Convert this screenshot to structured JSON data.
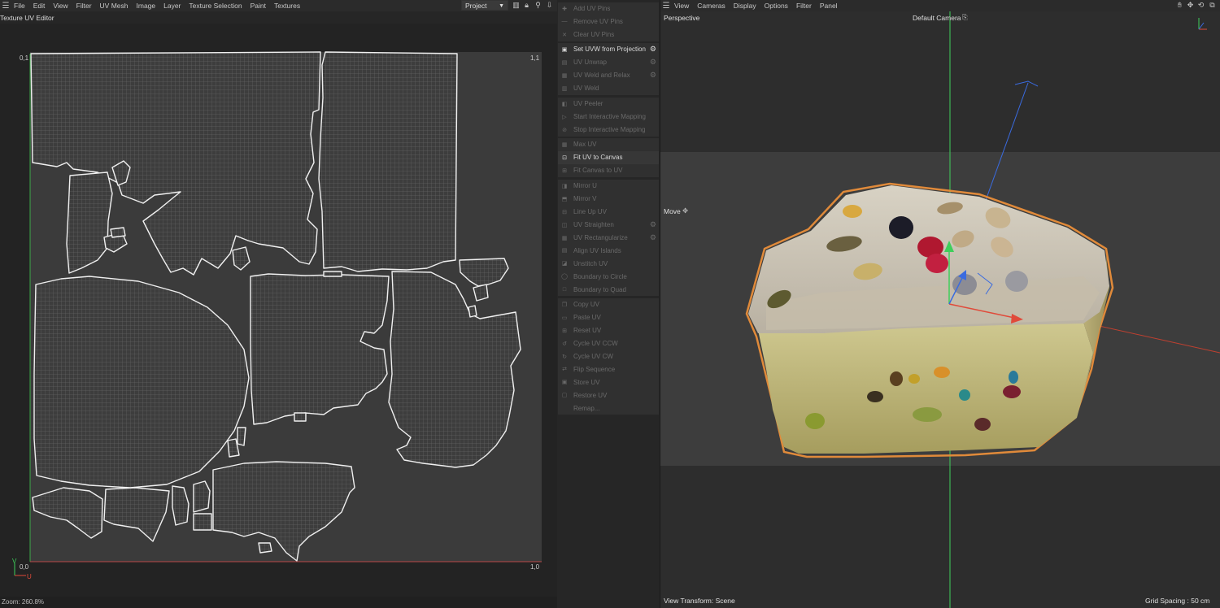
{
  "uv_editor": {
    "menu": [
      "File",
      "Edit",
      "View",
      "Filter",
      "UV Mesh",
      "Image",
      "Layer",
      "Texture Selection",
      "Paint",
      "Textures"
    ],
    "project_select": "Project",
    "title": "Texture UV Editor",
    "corners": {
      "top_left": "0,1",
      "top_right": "1,1",
      "bottom_left": "0,0",
      "bottom_right": "1,0"
    },
    "axis_v": "V",
    "axis_u": "U",
    "zoom": "Zoom: 260.8%"
  },
  "commands": {
    "group1": [
      {
        "label": "Add UV Pins",
        "icon": "pin-add-icon",
        "enabled": false
      },
      {
        "label": "Remove UV Pins",
        "icon": "pin-remove-icon",
        "enabled": false
      },
      {
        "label": "Clear UV Pins",
        "icon": "pin-clear-icon",
        "enabled": false
      }
    ],
    "group2": [
      {
        "label": "Set UVW from Projection",
        "icon": "projection-icon",
        "enabled": true,
        "gear": true
      },
      {
        "label": "UV Unwrap",
        "icon": "unwrap-icon",
        "enabled": false,
        "gear": true
      },
      {
        "label": "UV Weld and Relax",
        "icon": "weld-relax-icon",
        "enabled": false,
        "gear": true
      },
      {
        "label": "UV Weld",
        "icon": "weld-icon",
        "enabled": false
      }
    ],
    "group3": [
      {
        "label": "UV Peeler",
        "icon": "peeler-icon",
        "enabled": false
      },
      {
        "label": "Start Interactive Mapping",
        "icon": "play-icon",
        "enabled": false
      },
      {
        "label": "Stop Interactive Mapping",
        "icon": "stop-icon",
        "enabled": false
      }
    ],
    "group4": [
      {
        "label": "Max UV",
        "icon": "max-uv-icon",
        "enabled": false
      },
      {
        "label": "Fit UV to Canvas",
        "icon": "fit-uv-icon",
        "enabled": true
      },
      {
        "label": "Fit Canvas to UV",
        "icon": "fit-canvas-icon",
        "enabled": false
      }
    ],
    "group5": [
      {
        "label": "Mirror U",
        "icon": "mirror-u-icon",
        "enabled": false
      },
      {
        "label": "Mirror V",
        "icon": "mirror-v-icon",
        "enabled": false
      },
      {
        "label": "Line Up UV",
        "icon": "line-up-icon",
        "enabled": false
      },
      {
        "label": "UV Straighten",
        "icon": "straighten-icon",
        "enabled": false,
        "gear": true
      },
      {
        "label": "UV Rectangularize",
        "icon": "rectangularize-icon",
        "enabled": false,
        "gear": true
      },
      {
        "label": "Align UV Islands",
        "icon": "align-icon",
        "enabled": false
      },
      {
        "label": "Unstitch UV",
        "icon": "unstitch-icon",
        "enabled": false
      },
      {
        "label": "Boundary to Circle",
        "icon": "circle-icon",
        "enabled": false
      },
      {
        "label": "Boundary to Quad",
        "icon": "quad-icon",
        "enabled": false
      }
    ],
    "group6": [
      {
        "label": "Copy UV",
        "icon": "copy-icon",
        "enabled": false
      },
      {
        "label": "Paste UV",
        "icon": "paste-icon",
        "enabled": false
      },
      {
        "label": "Reset UV",
        "icon": "reset-icon",
        "enabled": false
      },
      {
        "label": "Cycle UV CCW",
        "icon": "cycle-ccw-icon",
        "enabled": false
      },
      {
        "label": "Cycle UV CW",
        "icon": "cycle-cw-icon",
        "enabled": false
      },
      {
        "label": "Flip Sequence",
        "icon": "flip-icon",
        "enabled": false
      },
      {
        "label": "Store UV",
        "icon": "store-icon",
        "enabled": false
      },
      {
        "label": "Restore UV",
        "icon": "restore-icon",
        "enabled": false
      },
      {
        "label": "Remap...",
        "icon": "remap-icon",
        "enabled": false
      }
    ]
  },
  "viewport": {
    "menu": [
      "View",
      "Cameras",
      "Display",
      "Options",
      "Filter",
      "Panel"
    ],
    "perspective": "Perspective",
    "camera": "Default Camera",
    "tool": "Move",
    "view_transform": "View Transform: Scene",
    "grid_spacing": "Grid Spacing : 50 cm"
  },
  "colors": {
    "accent_orange": "#e08a3a",
    "axis_red": "#e04a3a",
    "axis_green": "#3ecf5a",
    "axis_blue": "#3a6be0"
  }
}
